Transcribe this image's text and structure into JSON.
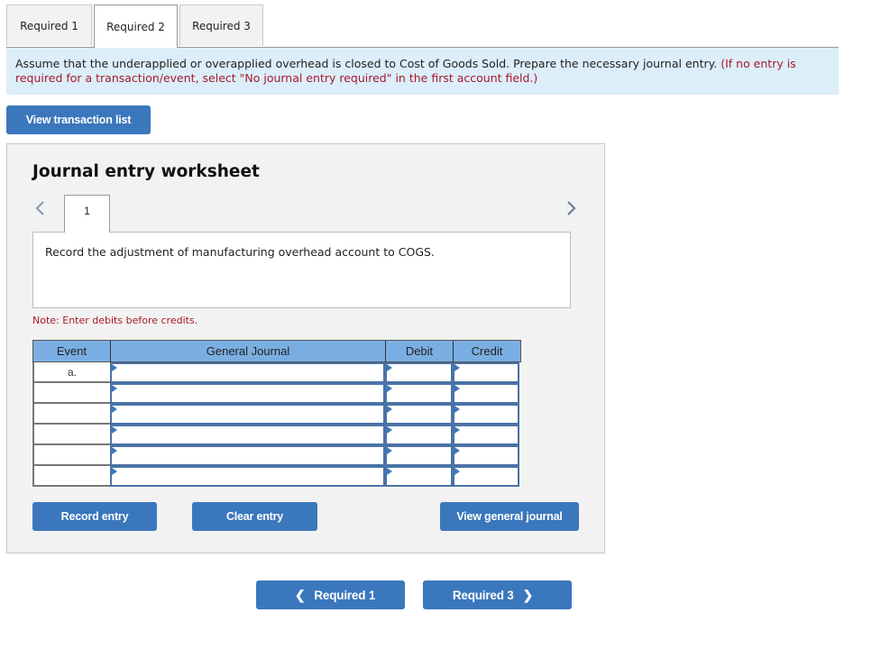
{
  "tabs": [
    {
      "label": "Required 1",
      "active": false
    },
    {
      "label": "Required 2",
      "active": true
    },
    {
      "label": "Required 3",
      "active": false
    }
  ],
  "instructions": {
    "text": "Assume that the underapplied or overapplied overhead is closed to Cost of Goods Sold. Prepare the necessary journal entry.",
    "hint": "(If no entry is required for a transaction/event, select \"No journal entry required\" in the first account field.)"
  },
  "view_transaction_list_label": "View transaction list",
  "worksheet": {
    "title": "Journal entry worksheet",
    "entry_tab": "1",
    "description": "Record the adjustment of manufacturing overhead account to COGS.",
    "note": "Note: Enter debits before credits.",
    "columns": {
      "event": "Event",
      "general_journal": "General Journal",
      "debit": "Debit",
      "credit": "Credit"
    },
    "rows": [
      {
        "event": "a.",
        "account": "",
        "debit": "",
        "credit": ""
      },
      {
        "event": "",
        "account": "",
        "debit": "",
        "credit": ""
      },
      {
        "event": "",
        "account": "",
        "debit": "",
        "credit": ""
      },
      {
        "event": "",
        "account": "",
        "debit": "",
        "credit": ""
      },
      {
        "event": "",
        "account": "",
        "debit": "",
        "credit": ""
      },
      {
        "event": "",
        "account": "",
        "debit": "",
        "credit": ""
      }
    ],
    "buttons": {
      "record": "Record entry",
      "clear": "Clear entry",
      "view_general_journal": "View general journal"
    }
  },
  "footer_nav": {
    "prev_label": "Required 1",
    "next_label": "Required 3"
  },
  "icons": {
    "prev": "chevron-left-icon",
    "next": "chevron-right-icon",
    "cell_marker": "triangle-right-icon"
  },
  "colors": {
    "button_blue": "#3b77bc",
    "header_blue": "#7aaee3",
    "instruction_bg": "#dbeefa",
    "hint_red": "#a8182b",
    "panel_bg": "#f2f2f2"
  }
}
